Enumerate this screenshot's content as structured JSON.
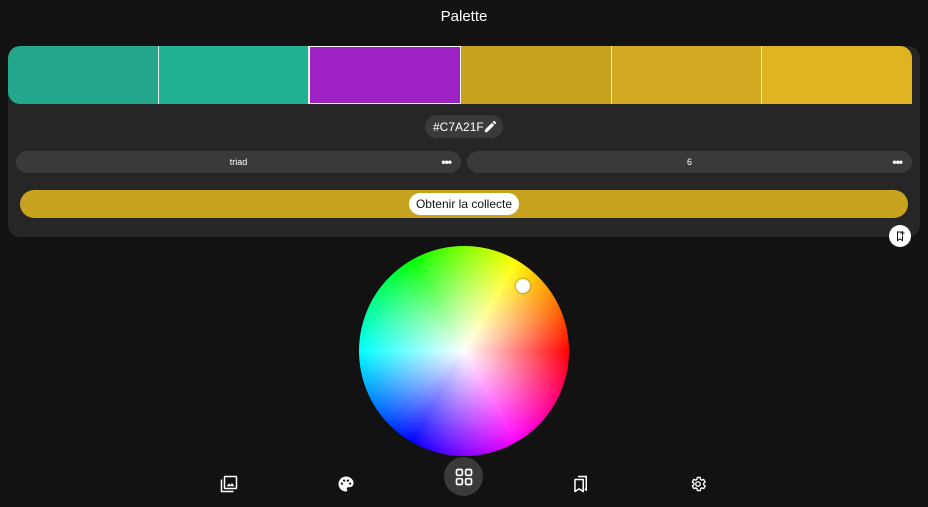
{
  "header": {
    "title": "Palette"
  },
  "palette": {
    "swatches": [
      {
        "color": "#23a68a"
      },
      {
        "color": "#23b193"
      },
      {
        "color": "#9e21c4"
      },
      {
        "color": "#c7a21f"
      },
      {
        "color": "#d4aa22"
      },
      {
        "color": "#e0b322"
      }
    ],
    "selected_index": 2,
    "hex_value": "#C7A21F",
    "scheme_type": "triad",
    "color_count": "6",
    "more_glyph": "•••",
    "collect_label": "Obtenir la collecte",
    "accent": "#c7a21f"
  },
  "wheel": {
    "selected_hue_hint": "yellow-orange"
  },
  "nav": {
    "items": [
      {
        "icon": "image-gallery-icon"
      },
      {
        "icon": "palette-icon"
      },
      {
        "icon": "grid-icon",
        "active": true
      },
      {
        "icon": "bookmarks-icon"
      },
      {
        "icon": "settings-gear-icon"
      }
    ]
  }
}
